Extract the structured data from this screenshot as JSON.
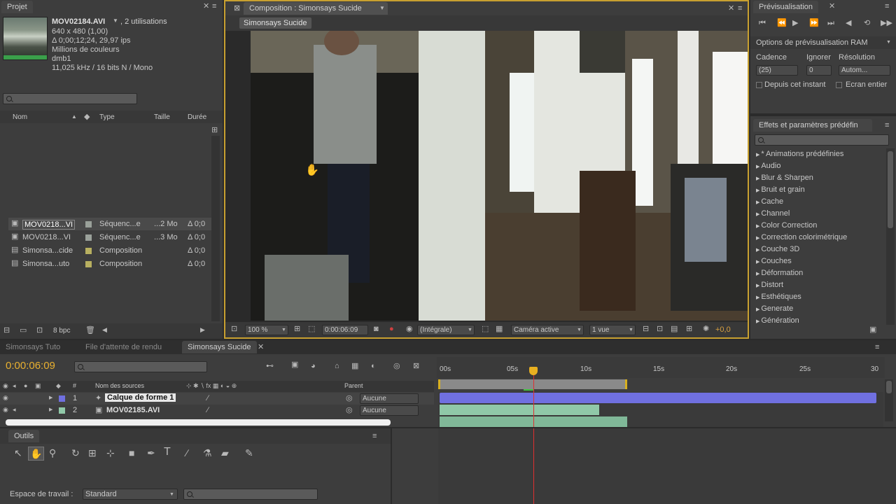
{
  "project": {
    "tab": "Projet",
    "file_name": "MOV02184.AVI",
    "file_usage": ", 2 utilisations",
    "file_info": [
      "640 x 480 (1,00)",
      "Δ 0;00;12;24, 29,97 ips",
      "Millions de couleurs",
      "dmb1",
      "11,025 kHz / 16 bits N / Mono"
    ],
    "columns": [
      "Nom",
      "Type",
      "Taille",
      "Durée"
    ],
    "items": [
      {
        "name": "MOV0218...VI",
        "type": "Séquenc...e",
        "size": "...2 Mo",
        "duration": "Δ 0;0",
        "color": "#9aa19a",
        "selected": true
      },
      {
        "name": "MOV0218...VI",
        "type": "Séquenc...e",
        "size": "...3 Mo",
        "duration": "Δ 0;0",
        "color": "#9aa19a",
        "selected": false
      },
      {
        "name": "Simonsa...cide",
        "type": "Composition",
        "size": "",
        "duration": "Δ 0;0",
        "color": "#b8b060",
        "selected": false
      },
      {
        "name": "Simonsa...uto",
        "type": "Composition",
        "size": "",
        "duration": "Δ 0;0",
        "color": "#b8b060",
        "selected": false
      }
    ],
    "bpc": "8 bpc"
  },
  "composition": {
    "tab": "Composition : Simonsays Sucide",
    "subtab": "Simonsays Sucide",
    "zoom": "100 %",
    "timecode": "0:00:06:09",
    "resolution": "(Intégrale)",
    "camera": "Caméra active",
    "views": "1 vue",
    "exposure": "+0,0"
  },
  "preview": {
    "tab": "Prévisualisation",
    "ram_options": "Options de prévisualisation RAM",
    "cadence_label": "Cadence",
    "ignore_label": "Ignorer",
    "resolution_label": "Résolution",
    "cadence_value": "(25)",
    "ignore_value": "0",
    "resolution_value": "Autom...",
    "from_current": "Depuis cet instant",
    "fullscreen": "Ecran entier"
  },
  "effects": {
    "tab": "Effets et paramètres prédéfin",
    "items": [
      "* Animations prédéfinies",
      "Audio",
      "Blur & Sharpen",
      "Bruit et grain",
      "Cache",
      "Channel",
      "Color Correction",
      "Correction colorimétrique",
      "Couche 3D",
      "Couches",
      "Déformation",
      "Distort",
      "Esthétiques",
      "Generate",
      "Génération"
    ]
  },
  "timeline": {
    "tabs": [
      "Simonsays Tuto",
      "File d'attente de rendu",
      "Simonsays Sucide"
    ],
    "timecode": "0:00:06:09",
    "col_sources": "Nom des sources",
    "col_parent": "Parent",
    "col_hash": "#",
    "ruler": [
      "00s",
      "05s",
      "10s",
      "15s",
      "20s",
      "25s",
      "30"
    ],
    "layers": [
      {
        "num": "1",
        "name": "Calque de forme 1",
        "parent": "Aucune",
        "color": "#7070e0"
      },
      {
        "num": "2",
        "name": "MOV02185.AVI",
        "parent": "Aucune",
        "color": "#90c8a8"
      }
    ]
  },
  "tools": {
    "tab": "Outils",
    "workspace_label": "Espace de travail :",
    "workspace_value": "Standard"
  }
}
